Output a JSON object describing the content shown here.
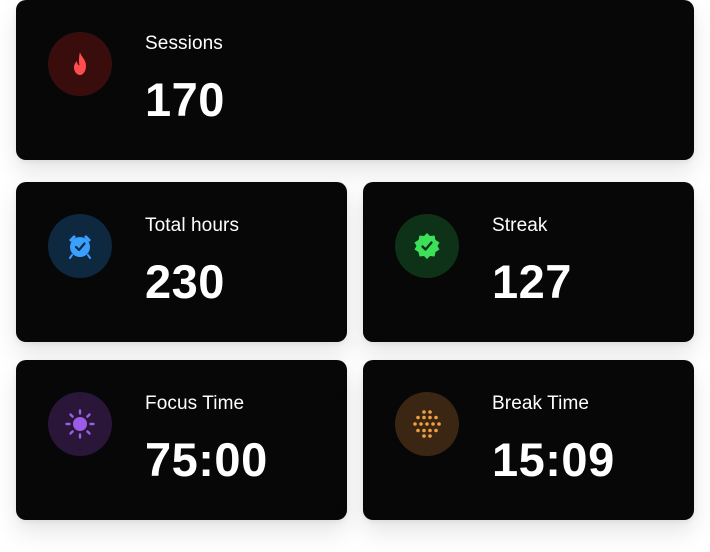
{
  "cards": [
    {
      "label": "Sessions",
      "value": "170",
      "icon": "fire-icon",
      "accent": "#ff4d4d"
    },
    {
      "label": "Total hours",
      "value": "230",
      "icon": "alarm-clock-icon",
      "accent": "#3aa0ff"
    },
    {
      "label": "Streak",
      "value": "127",
      "icon": "verified-badge-icon",
      "accent": "#3ee05a"
    },
    {
      "label": "Focus Time",
      "value": "75:00",
      "icon": "sun-icon",
      "accent": "#9b5de5"
    },
    {
      "label": "Break Time",
      "value": "15:09",
      "icon": "dots-grid-icon",
      "accent": "#f0a040"
    }
  ]
}
